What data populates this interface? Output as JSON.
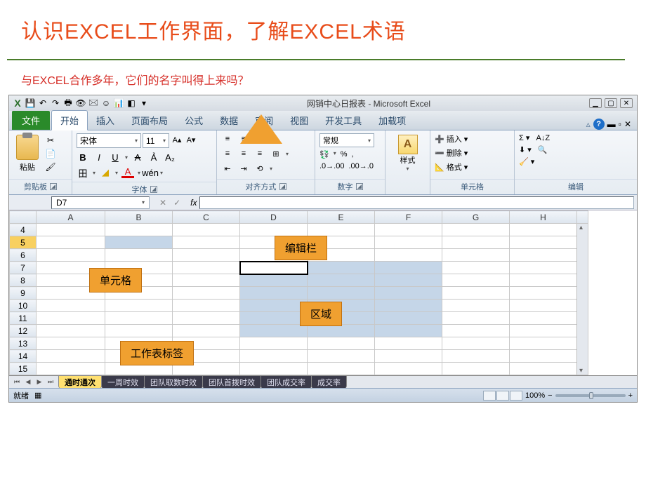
{
  "slide": {
    "title": "认识EXCEL工作界面，了解EXCEL术语",
    "subtitle": "与EXCEL合作多年，它们的名字叫得上来吗？"
  },
  "titlebar": {
    "app_title": "网销中心日报表 - Microsoft Excel",
    "qat_icons": [
      "X",
      "💾",
      "↶",
      "↷",
      "🖶",
      "👁",
      "🖂",
      "☺",
      "📊",
      "◧",
      "▾"
    ]
  },
  "tabs": {
    "file": "文件",
    "items": [
      "开始",
      "插入",
      "页面布局",
      "公式",
      "数据",
      "审阅",
      "视图",
      "开发工具",
      "加载项"
    ],
    "active_index": 0
  },
  "ribbon": {
    "clipboard": {
      "label": "剪贴板",
      "paste": "粘贴"
    },
    "font": {
      "label": "字体",
      "name": "宋体",
      "size": "11"
    },
    "alignment": {
      "label": "对齐方式"
    },
    "number": {
      "label": "数字",
      "format": "常规"
    },
    "styles": {
      "label": "样式"
    },
    "cells": {
      "label": "单元格",
      "insert": "插入",
      "delete": "删除",
      "format": "格式"
    },
    "editing": {
      "label": "编辑"
    }
  },
  "namebox": {
    "value": "D7"
  },
  "columns": [
    "A",
    "B",
    "C",
    "D",
    "E",
    "F",
    "G",
    "H"
  ],
  "rows": [
    "4",
    "5",
    "6",
    "7",
    "8",
    "9",
    "10",
    "11",
    "12",
    "13",
    "14",
    "15"
  ],
  "callouts": {
    "formula_bar": "编辑栏",
    "cell": "单元格",
    "range": "区域",
    "sheet_tab": "工作表标签"
  },
  "sheets": {
    "active": "通时通次",
    "others": [
      "一周时效",
      "团队取数时效",
      "团队首拨时效",
      "团队成交率",
      "成交率"
    ]
  },
  "status": {
    "ready": "就绪",
    "zoom": "100%"
  }
}
